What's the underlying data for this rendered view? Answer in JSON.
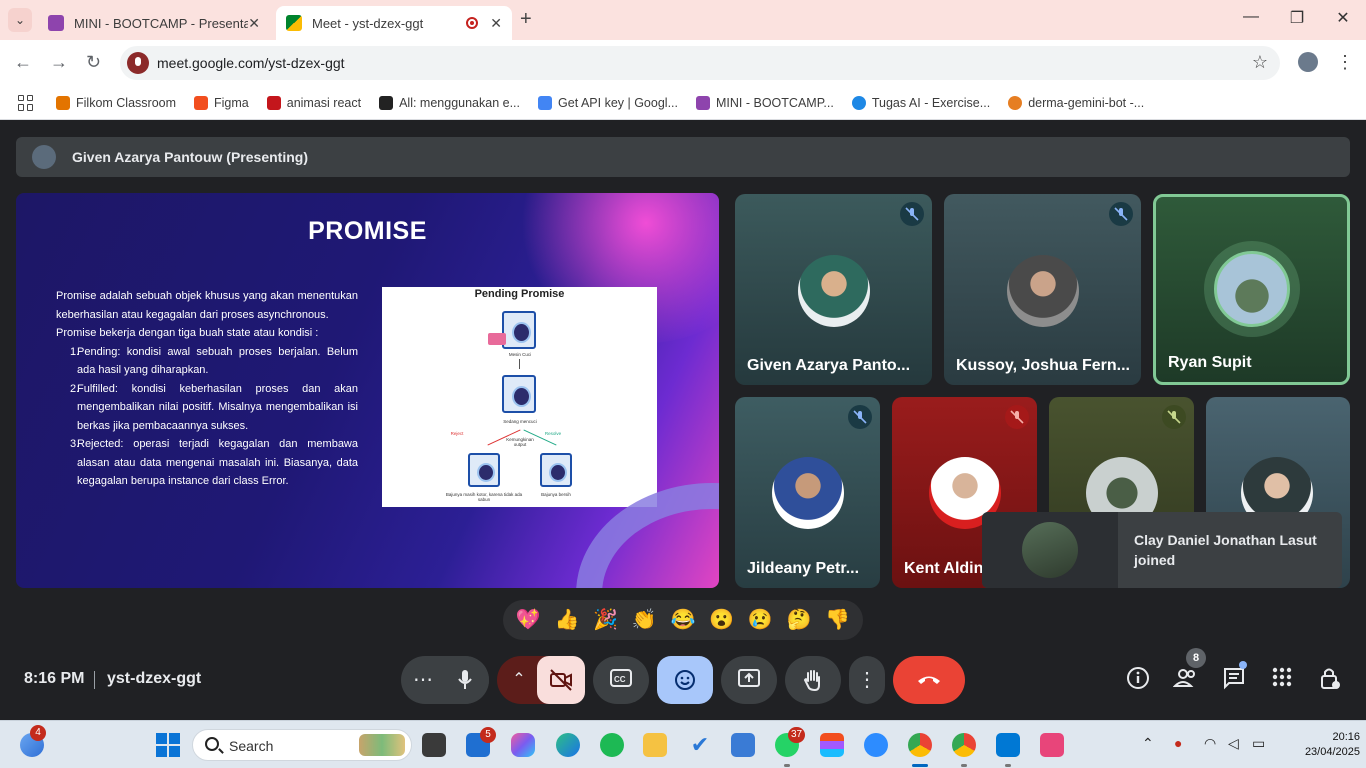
{
  "browser": {
    "tabs": [
      {
        "title": "MINI - BOOTCAMP - Presentasi",
        "active": false
      },
      {
        "title": "Meet - yst-dzex-ggt",
        "active": true
      }
    ],
    "url": "meet.google.com/yst-dzex-ggt",
    "bookmarks": [
      {
        "label": "Filkom Classroom",
        "color": "#e37400"
      },
      {
        "label": "Figma",
        "color": "#f24e1e"
      },
      {
        "label": "animasi react",
        "color": "#c4161c"
      },
      {
        "label": "All: menggunakan e...",
        "color": "#222222"
      },
      {
        "label": "Get API key | Googl...",
        "color": "#4285f4"
      },
      {
        "label": "MINI - BOOTCAMP...",
        "color": "#8e44ad"
      },
      {
        "label": "Tugas AI - Exercise...",
        "color": "#1e88e5"
      },
      {
        "label": "derma-gemini-bot -...",
        "color": "#e67e22"
      }
    ]
  },
  "meet": {
    "presenting_banner": "Given Azarya Pantouw (Presenting)",
    "slide": {
      "title": "PROMISE",
      "para1": "Promise adalah sebuah objek khusus yang akan menentukan keberhasilan atau kegagalan dari proses asynchronous.",
      "para2": "Promise bekerja dengan tiga buah state atau kondisi :",
      "items": [
        {
          "num": "1.",
          "text": "Pending: kondisi awal sebuah proses berjalan. Belum ada hasil yang diharapkan."
        },
        {
          "num": "2.",
          "text": "Fulfilled: kondisi keberhasilan proses dan akan mengembalikan nilai positif. Misalnya mengembalikan isi berkas jika pembacaannya sukses."
        },
        {
          "num": "3.",
          "text": "Rejected: operasi terjadi kegagalan dan membawa alasan atau data mengenai masalah ini. Biasanya, data kegagalan berupa instance dari class Error."
        }
      ],
      "image_title": "Pending Promise",
      "image_captions": {
        "machine": "Mesin Cuci",
        "washing": "Sedang mencuci",
        "reject": "Reject",
        "resolve": "Resolve",
        "output": "Kemungkinan output",
        "dirty": "Bajunya masih kotor, karena tidak ada sabun",
        "clean": "Bajunya bersih"
      }
    },
    "participants": [
      {
        "name": "Given Azarya Panto...",
        "muted": true
      },
      {
        "name": "Kussoy, Joshua Fern...",
        "muted": true
      },
      {
        "name": "Ryan Supit",
        "muted": false,
        "speaking": true
      },
      {
        "name": "Jildeany Petr...",
        "muted": true
      },
      {
        "name": "Kent Aldin",
        "muted": true
      },
      {
        "name": "",
        "muted": true
      },
      {
        "name": "",
        "muted": false
      }
    ],
    "toast": "Clay Daniel Jonathan Lasut joined",
    "reactions": [
      "💖",
      "👍",
      "🎉",
      "👏",
      "😂",
      "😮",
      "😢",
      "🤔",
      "👎"
    ],
    "time": "8:16 PM",
    "meeting_code": "yst-dzex-ggt",
    "people_count": "8",
    "colors": {
      "end_call": "#ea4335",
      "camera_off": "#f9dedc",
      "emoji_active": "#a8c7fa"
    }
  },
  "taskbar": {
    "search_label": "Search",
    "widget_badge": "4",
    "badges": {
      "task": "5",
      "whatsapp": "37"
    },
    "time": "20:16",
    "date": "23/04/2025"
  }
}
